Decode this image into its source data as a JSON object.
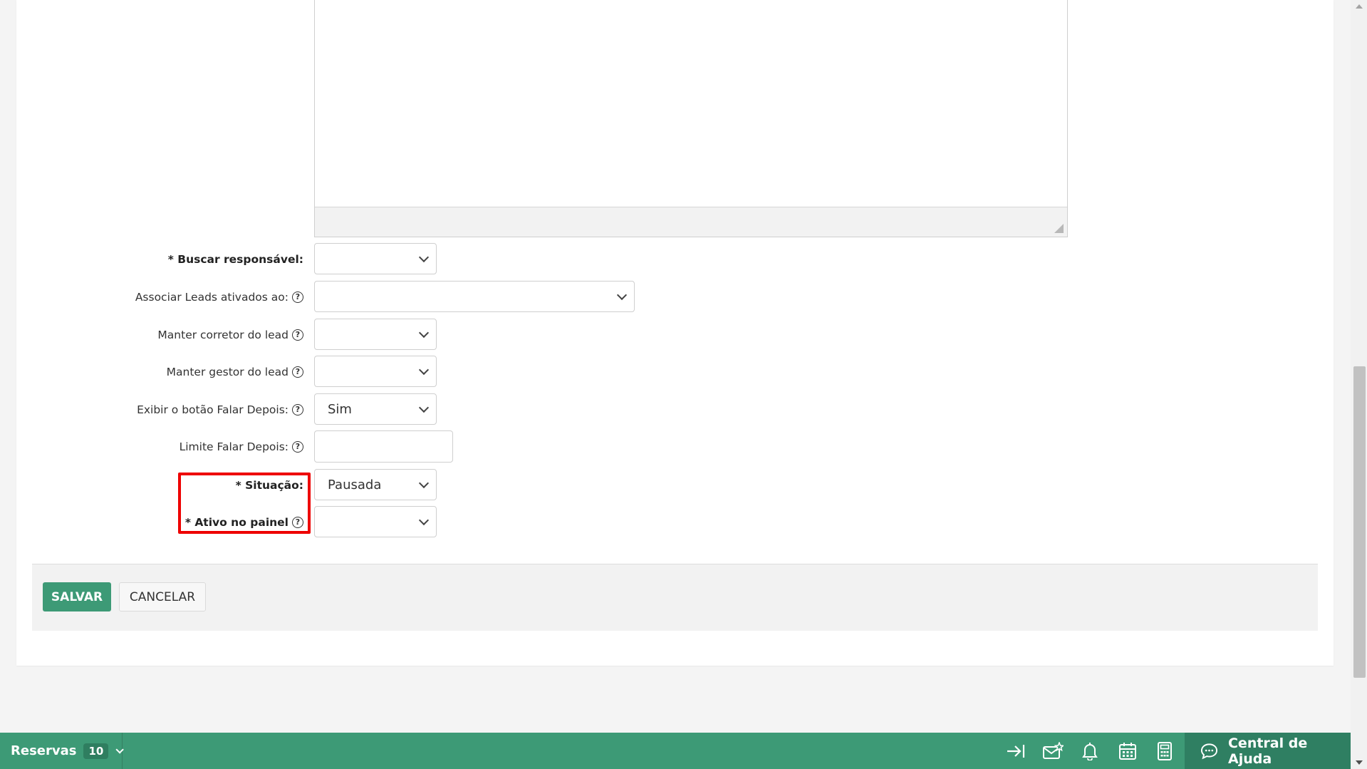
{
  "form": {
    "fields": [
      {
        "label": "* Buscar responsável:",
        "value": "",
        "bold": true,
        "help": false
      },
      {
        "label": "Associar Leads ativados ao:",
        "value": "",
        "bold": false,
        "help": true
      },
      {
        "label": "Manter corretor do lead",
        "value": "",
        "bold": false,
        "help": true
      },
      {
        "label": "Manter gestor do lead",
        "value": "",
        "bold": false,
        "help": true
      },
      {
        "label": "Exibir o botão Falar Depois:",
        "value": "Sim",
        "bold": false,
        "help": true
      },
      {
        "label": "Limite Falar Depois:",
        "value": "",
        "bold": false,
        "help": true
      },
      {
        "label": "* Situação:",
        "value": "Pausada",
        "bold": true,
        "help": false
      },
      {
        "label": "* Ativo no painel",
        "value": "",
        "bold": true,
        "help": true
      }
    ],
    "help_glyph": "?"
  },
  "actions": {
    "save_label": "SALVAR",
    "cancel_label": "CANCELAR"
  },
  "bottom_bar": {
    "reserves_label": "Reservas",
    "reserves_count": "10",
    "help_center_label": "Central de Ajuda",
    "icons": [
      "collapse-arrow-icon",
      "mail-star-icon",
      "bell-icon",
      "calendar-icon",
      "calculator-icon",
      "chat-help-icon"
    ]
  },
  "colors": {
    "brand_green": "#3d9a76",
    "dark_green": "#2f7f62",
    "highlight_red": "#ee0000"
  }
}
